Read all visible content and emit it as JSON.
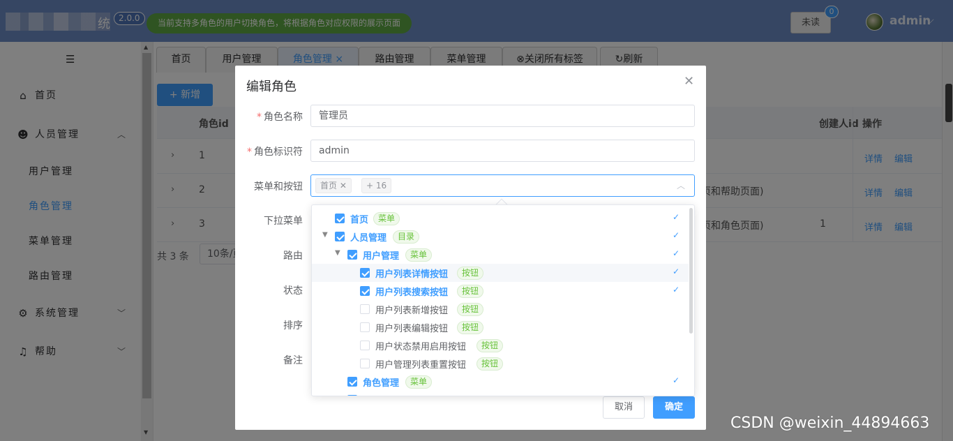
{
  "header": {
    "logo_tail": "统",
    "version": "2.0.0",
    "notice": "当前支持多角色的用户切换角色，将根据角色对应权限的展示页面",
    "unread_label": "未读",
    "unread_count": "0",
    "username": "admin"
  },
  "sidebar": {
    "items": [
      {
        "label": "首页",
        "icon": "home-icon"
      },
      {
        "label": "人员管理",
        "icon": "user-icon"
      },
      {
        "label": "用户管理"
      },
      {
        "label": "角色管理"
      },
      {
        "label": "菜单管理"
      },
      {
        "label": "路由管理"
      },
      {
        "label": "系统管理",
        "icon": "gear-icon"
      },
      {
        "label": "帮助",
        "icon": "headset-icon"
      }
    ]
  },
  "tabs": [
    "首页",
    "用户管理",
    "角色管理",
    "路由管理",
    "菜单管理",
    "关闭所有标签",
    "刷新"
  ],
  "toolbar": {
    "add_label": "+ 新增"
  },
  "table": {
    "headers": {
      "id": "角色id",
      "creator": "创建人id",
      "op": "操作"
    },
    "rows": [
      {
        "id": "1",
        "desc": "",
        "creator": ""
      },
      {
        "id": "2",
        "desc": "页和帮助页面)",
        "creator": ""
      },
      {
        "id": "3",
        "desc": "页和角色页面)",
        "creator": "1"
      }
    ],
    "op_detail": "详情",
    "op_edit": "编辑"
  },
  "pager": {
    "total": "共 3 条",
    "size": "10条/页"
  },
  "dialog": {
    "title": "编辑角色",
    "fields": {
      "name_label": "角色名称",
      "name_value": "管理员",
      "code_label": "角色标识符",
      "code_value": "admin",
      "menus_label": "菜单和按钮",
      "dropdown_label": "下拉菜单",
      "route_label": "路由",
      "status_label": "状态",
      "sort_label": "排序",
      "remark_label": "备注"
    },
    "select": {
      "chip1": "首页",
      "chip_more": "+ 16"
    },
    "cancel_label": "取消",
    "ok_label": "确定"
  },
  "tree": [
    {
      "label": "首页",
      "tag": "菜单",
      "checked": true,
      "level": 0
    },
    {
      "label": "人员管理",
      "tag": "目录",
      "checked": true,
      "level": 0
    },
    {
      "label": "用户管理",
      "tag": "菜单",
      "checked": true,
      "level": 1
    },
    {
      "label": "用户列表详情按钮",
      "tag": "按钮",
      "checked": true,
      "level": 2
    },
    {
      "label": "用户列表搜索按钮",
      "tag": "按钮",
      "checked": true,
      "level": 2
    },
    {
      "label": "用户列表新增按钮",
      "tag": "按钮",
      "checked": false,
      "level": 2
    },
    {
      "label": "用户列表编辑按钮",
      "tag": "按钮",
      "checked": false,
      "level": 2
    },
    {
      "label": "用户状态禁用启用按钮",
      "tag": "按钮",
      "checked": false,
      "level": 2
    },
    {
      "label": "用户管理列表重置按钮",
      "tag": "按钮",
      "checked": false,
      "level": 2
    },
    {
      "label": "角色管理",
      "tag": "菜单",
      "checked": true,
      "level": 1
    }
  ],
  "watermark": "CSDN @weixin_44894663"
}
